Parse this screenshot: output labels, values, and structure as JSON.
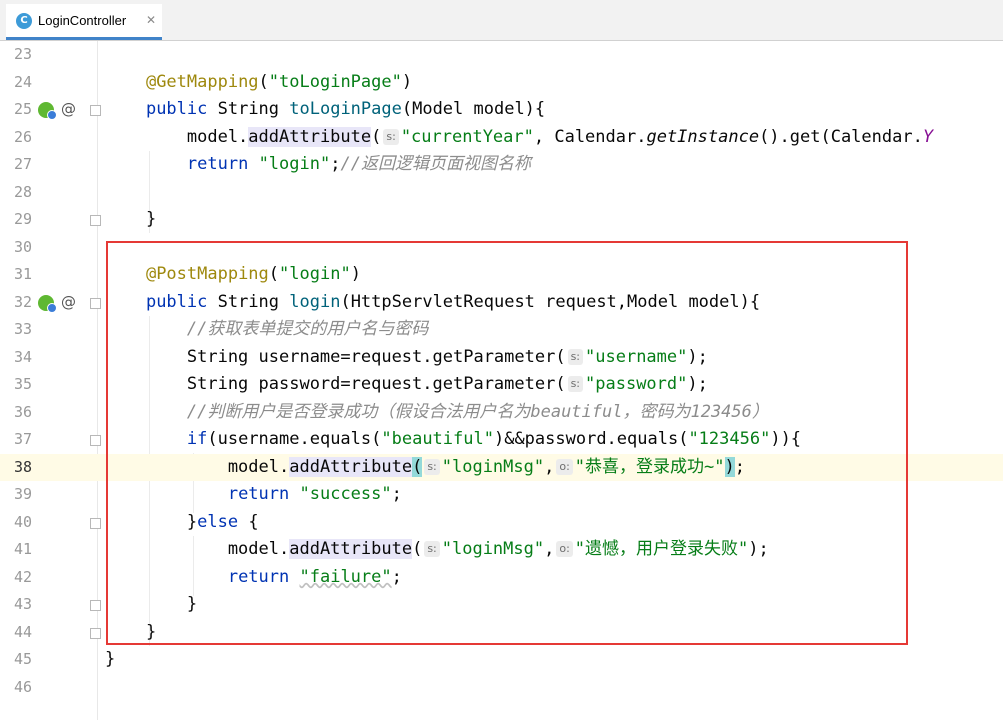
{
  "tab": {
    "icon_letter": "C",
    "title": "LoginController",
    "close": "✕"
  },
  "gutter": {
    "at_symbol": "@"
  },
  "lines": [
    {
      "n": "23"
    },
    {
      "n": "24",
      "tokens": {
        "t0": "    ",
        "t1": "@GetMapping",
        "t2": "(",
        "t3": "\"toLoginPage\"",
        "t4": ")"
      }
    },
    {
      "n": "25",
      "tokens": {
        "t0": "    ",
        "t1": "public",
        "t2": " String ",
        "t3": "toLoginPage",
        "t4": "(Model model){"
      }
    },
    {
      "n": "26",
      "tokens": {
        "t0": "        model.",
        "t1": "addAttribute",
        "t2": "(",
        "hint": "s:",
        "t3": "\"currentYear\"",
        "t4": ", Calendar.",
        "t5": "getInstance",
        "t6": "().get(Calendar.",
        "t7": "Y"
      }
    },
    {
      "n": "27",
      "tokens": {
        "t0": "        ",
        "t1": "return",
        "t2": " ",
        "t3": "\"login\"",
        "t4": ";",
        "t5": "//返回逻辑页面视图名称"
      }
    },
    {
      "n": "28"
    },
    {
      "n": "29",
      "tokens": {
        "t0": "    }"
      }
    },
    {
      "n": "30"
    },
    {
      "n": "31",
      "tokens": {
        "t0": "    ",
        "t1": "@PostMapping",
        "t2": "(",
        "t3": "\"login\"",
        "t4": ")"
      }
    },
    {
      "n": "32",
      "tokens": {
        "t0": "    ",
        "t1": "public",
        "t2": " String ",
        "t3": "login",
        "t4": "(HttpServletRequest request,Model model){"
      }
    },
    {
      "n": "33",
      "tokens": {
        "t0": "        ",
        "t1": "//获取表单提交的用户名与密码"
      }
    },
    {
      "n": "34",
      "tokens": {
        "t0": "        String username=request.getParameter(",
        "hint": "s:",
        "t1": "\"username\"",
        "t2": ");"
      }
    },
    {
      "n": "35",
      "tokens": {
        "t0": "        String password=request.getParameter(",
        "hint": "s:",
        "t1": "\"password\"",
        "t2": ");"
      }
    },
    {
      "n": "36",
      "tokens": {
        "t0": "        ",
        "t1": "//判断用户是否登录成功（假设合法用户名为beautiful，密码为123456）"
      }
    },
    {
      "n": "37",
      "tokens": {
        "t0": "        ",
        "t1": "if",
        "t2": "(username.equals(",
        "t3": "\"beautiful\"",
        "t4": ")&&password.equals(",
        "t5": "\"123456\"",
        "t6": ")){"
      }
    },
    {
      "n": "38",
      "tokens": {
        "t0": "            model.",
        "t1": "addAttribute",
        "t2": "(",
        "hint1": "s:",
        "t3": "\"loginMsg\"",
        "t4": ",",
        "hint2": "o:",
        "t5": "\"恭喜，登录成功~\"",
        "t6": ")",
        "t7": ";"
      }
    },
    {
      "n": "39",
      "tokens": {
        "t0": "            ",
        "t1": "return",
        "t2": " ",
        "t3": "\"success\"",
        "t4": ";"
      }
    },
    {
      "n": "40",
      "tokens": {
        "t0": "        }",
        "t1": "else",
        "t2": " {"
      }
    },
    {
      "n": "41",
      "tokens": {
        "t0": "            model.",
        "t1": "addAttribute",
        "t2": "(",
        "hint1": "s:",
        "t3": "\"loginMsg\"",
        "t4": ",",
        "hint2": "o:",
        "t5": "\"遗憾，用户登录失败\"",
        "t6": ");"
      }
    },
    {
      "n": "42",
      "tokens": {
        "t0": "            ",
        "t1": "return",
        "t2": " ",
        "t3": "\"failure\"",
        "t4": ";"
      }
    },
    {
      "n": "43",
      "tokens": {
        "t0": "        }"
      }
    },
    {
      "n": "44",
      "tokens": {
        "t0": "    }"
      }
    },
    {
      "n": "45",
      "tokens": {
        "t0": "}"
      }
    },
    {
      "n": "46"
    }
  ],
  "colors": {
    "keyword": "#0033b3",
    "annotation": "#9e880d",
    "string": "#067d17",
    "comment": "#8c8c8c",
    "method_decl": "#00627a",
    "highlight_box": "#e53935",
    "current_line": "#fffbe6"
  },
  "icons": {
    "tab_icon": "class-icon",
    "gutter_marker": "spring-bean-icon",
    "gutter_at": "request-mapping-icon"
  }
}
